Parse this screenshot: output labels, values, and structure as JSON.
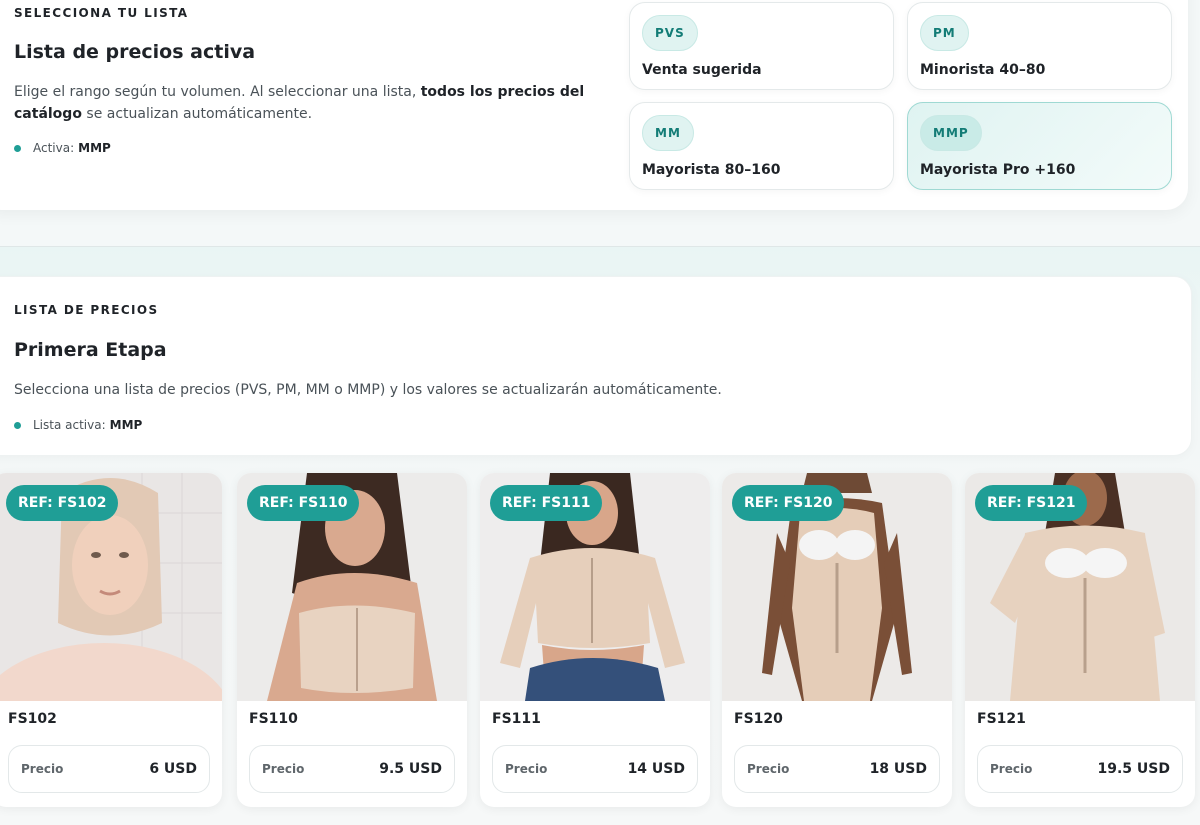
{
  "selector": {
    "eyebrow": "SELECCIONA TU LISTA",
    "title": "Lista de precios activa",
    "description_start": "Elige el rango según tu volumen. Al seleccionar una lista,",
    "description_bold": "todos los precios del catálogo",
    "description_end": "se actualizan automáticamente.",
    "active_label": "Activa:",
    "active_value": "MMP",
    "options": [
      {
        "code": "PVS",
        "label": "Venta sugerida",
        "active": false
      },
      {
        "code": "PM",
        "label": "Minorista 40–80",
        "active": false
      },
      {
        "code": "MM",
        "label": "Mayorista 80–160",
        "active": false
      },
      {
        "code": "MMP",
        "label": "Mayorista Pro +160",
        "active": true
      }
    ]
  },
  "pricelist": {
    "eyebrow": "LISTA DE PRECIOS",
    "title": "Primera Etapa",
    "description": "Selecciona una lista de precios (PVS, PM, MM o MMP) y los valores se actualizarán automáticamente.",
    "active_label": "Lista activa:",
    "active_value": "MMP"
  },
  "products": [
    {
      "ref": "REF: FS102",
      "name": "FS102",
      "price_label": "Precio",
      "price": "6 USD",
      "photo": "face-wrap-photo"
    },
    {
      "ref": "REF: FS110",
      "name": "FS110",
      "price_label": "Precio",
      "price": "9.5 USD",
      "photo": "bra-top-photo"
    },
    {
      "ref": "REF: FS111",
      "name": "FS111",
      "price_label": "Precio",
      "price": "14 USD",
      "photo": "sleeve-top-photo"
    },
    {
      "ref": "REF: FS120",
      "name": "FS120",
      "price_label": "Precio",
      "price": "18 USD",
      "photo": "bodysuit-photo"
    },
    {
      "ref": "REF: FS121",
      "name": "FS121",
      "price_label": "Precio",
      "price": "19.5 USD",
      "photo": "long-sleeve-bodysuit-photo"
    }
  ],
  "colors": {
    "accent": "#1f9e96",
    "pill_bg": "#e0f3f1",
    "active_card_border": "#9fd9d3",
    "text": "#1f2328"
  }
}
